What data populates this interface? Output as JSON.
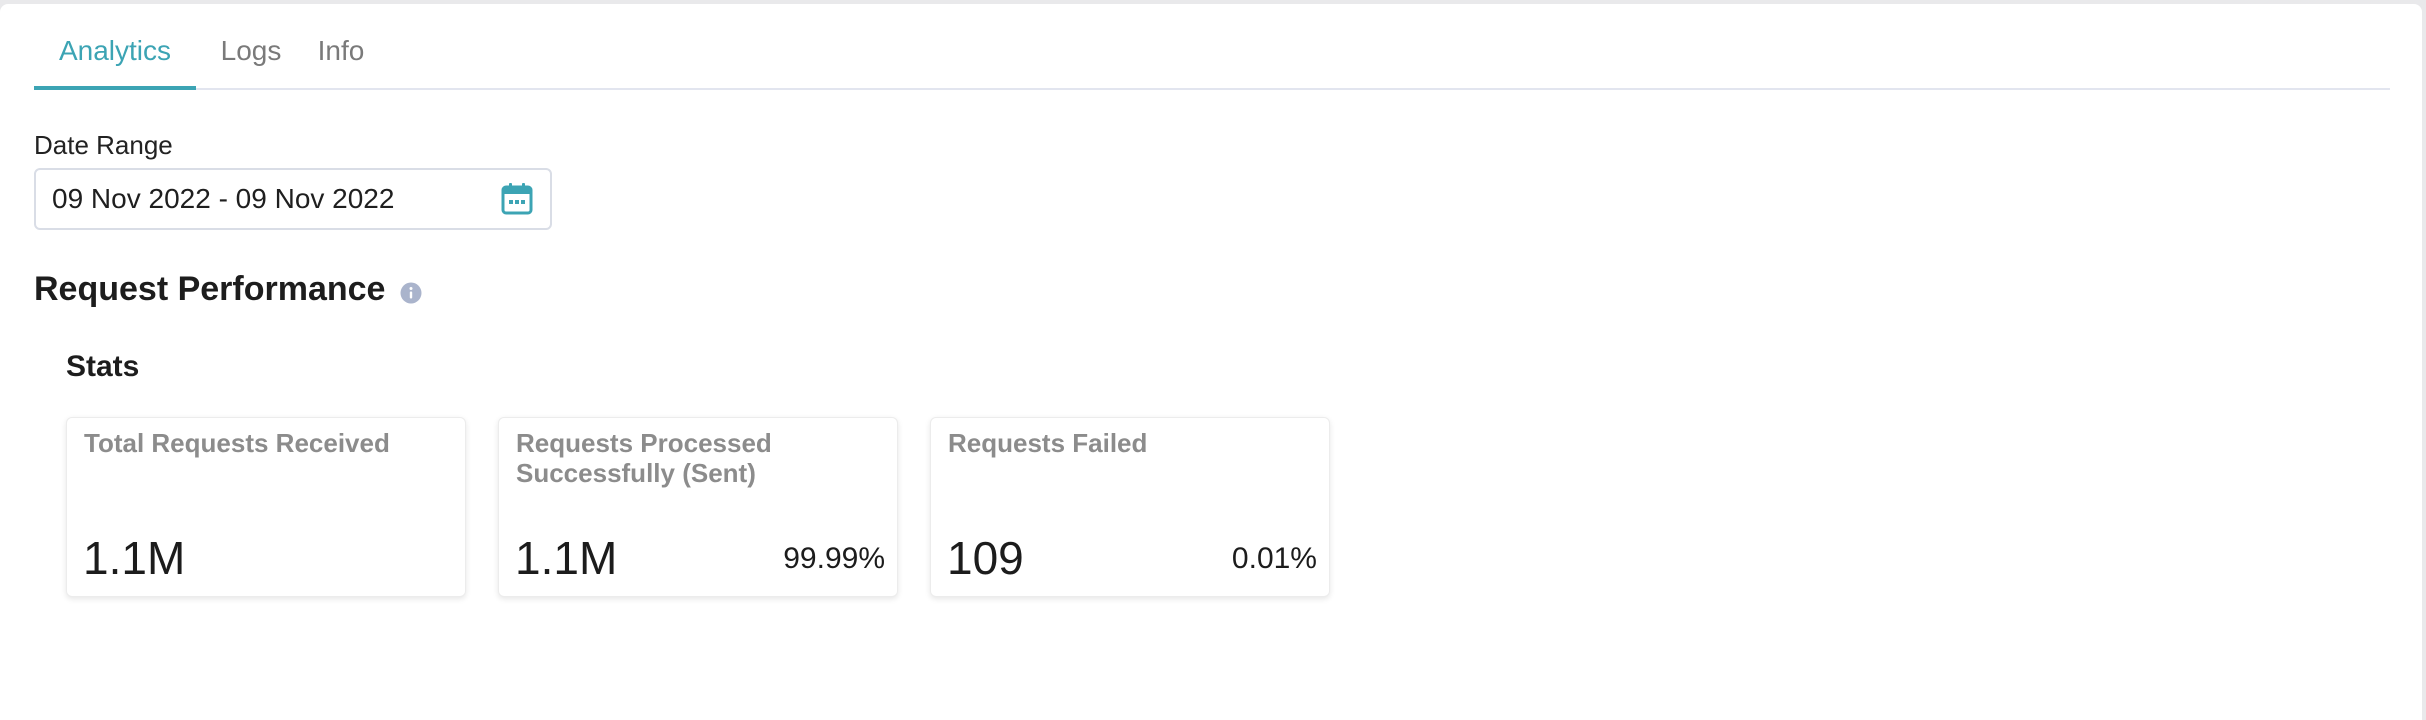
{
  "tabs": [
    {
      "label": "Analytics",
      "active": true
    },
    {
      "label": "Logs",
      "active": false
    },
    {
      "label": "Info",
      "active": false
    }
  ],
  "date_range": {
    "label": "Date Range",
    "value": "09 Nov 2022 - 09 Nov 2022",
    "icon": "calendar-icon"
  },
  "section": {
    "title": "Request Performance",
    "info_icon": "info-icon"
  },
  "stats": {
    "title": "Stats",
    "cards": [
      {
        "label": "Total Requests Received",
        "value": "1.1M",
        "percent": ""
      },
      {
        "label": "Requests Processed Successfully (Sent)",
        "value": "1.1M",
        "percent": "99.99%"
      },
      {
        "label": "Requests Failed",
        "value": "109",
        "percent": "0.01%"
      }
    ]
  },
  "colors": {
    "accent": "#3ca4b4",
    "muted_text": "#8c8c8c",
    "info_icon": "#aab4cc",
    "divider": "#e2e5ef"
  }
}
